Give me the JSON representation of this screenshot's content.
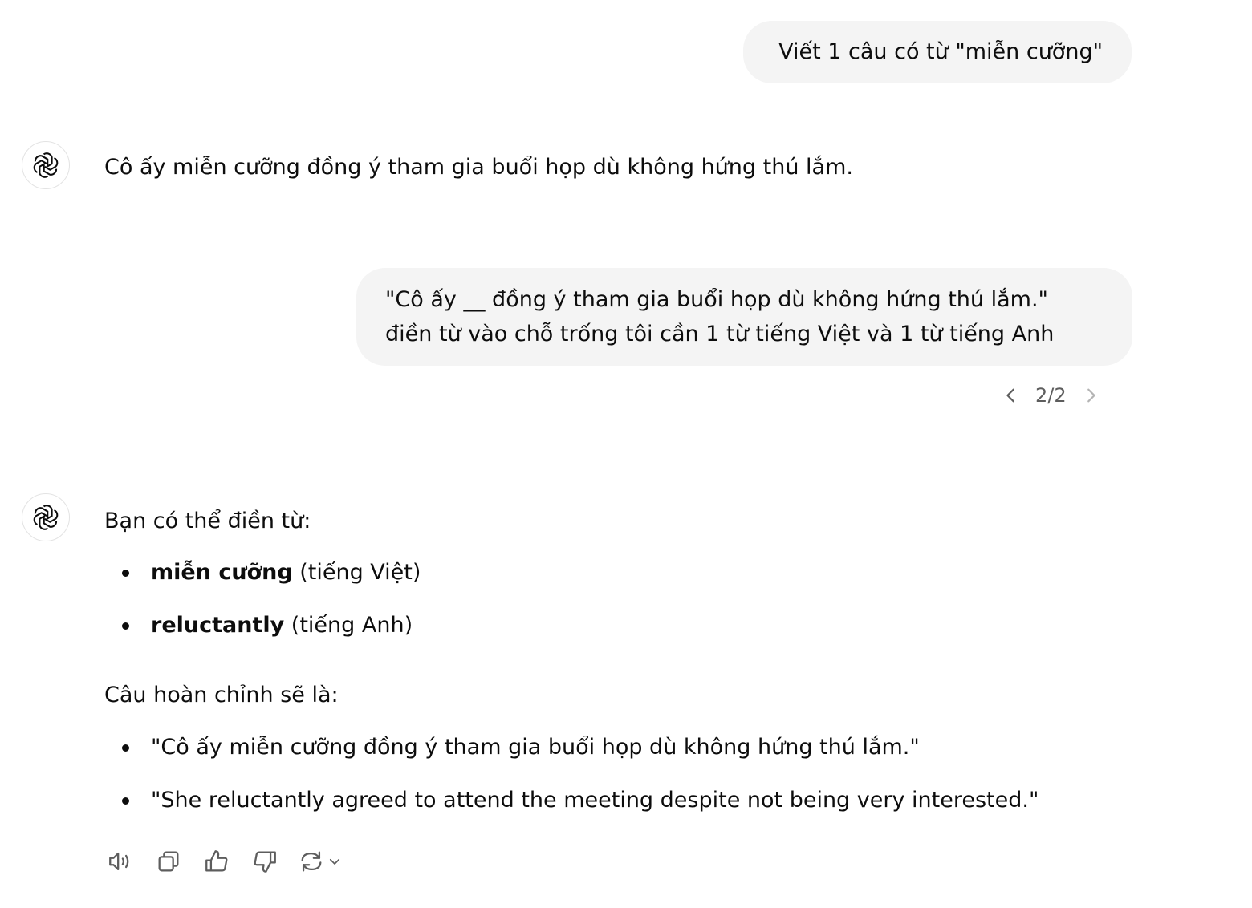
{
  "conversation": {
    "user_msg_1": "Viết 1 câu có từ \"miễn cưỡng\"",
    "assistant_msg_1": "Cô ấy miễn cưỡng đồng ý tham gia buổi họp dù không hứng thú lắm.",
    "user_msg_2": "\"Cô ấy __ đồng ý tham gia buổi họp dù không hứng thú lắm.\" điền từ vào chỗ trống tôi cần 1 từ tiếng Việt và 1 từ tiếng Anh",
    "pager": "2/2",
    "assistant_msg_2": {
      "intro": "Bạn có thể điền từ:",
      "options": [
        {
          "bold": "miễn cưỡng",
          "rest": " (tiếng Việt)"
        },
        {
          "bold": "reluctantly",
          "rest": " (tiếng Anh)"
        }
      ],
      "complete_label": "Câu hoàn chỉnh sẽ là:",
      "sentences": [
        "\"Cô ấy miễn cưỡng đồng ý tham gia buổi họp dù không hứng thú lắm.\"",
        "\"She reluctantly agreed to attend the meeting despite not being very interested.\""
      ]
    }
  },
  "icons": {
    "avatar": "openai-logo-icon",
    "prev": "chevron-left-icon",
    "next": "chevron-right-icon",
    "actions": [
      "speaker-icon",
      "copy-icon",
      "thumbs-up-icon",
      "thumbs-down-icon",
      "regenerate-icon",
      "chevron-down-icon"
    ]
  },
  "colors": {
    "bubble_bg": "#f4f4f4",
    "text": "#0d0d0d",
    "muted": "#5d5d5d"
  }
}
